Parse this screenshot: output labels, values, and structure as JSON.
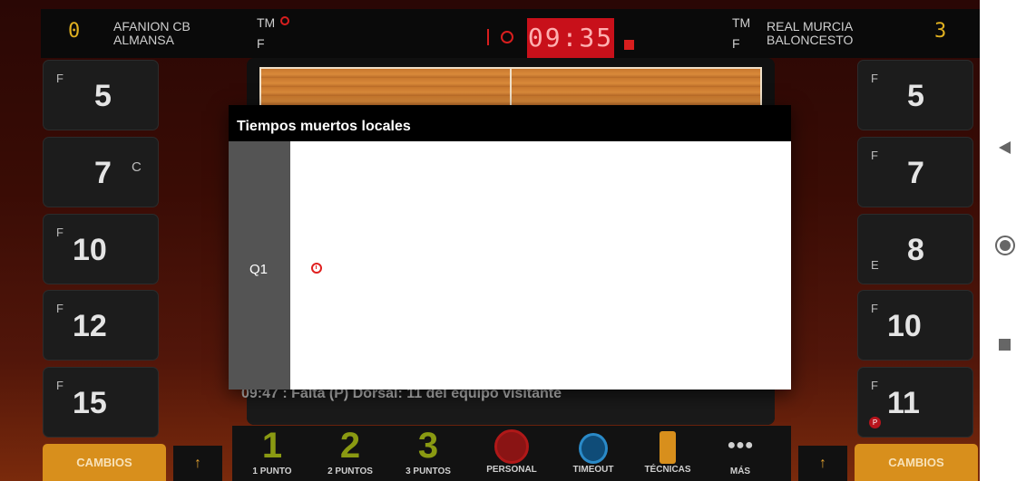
{
  "header": {
    "home_score_display": "0",
    "home_name_line1": "AFANION CB",
    "home_name_line2": "ALMANSA",
    "home_tm_label": "TM",
    "home_f_label": "F",
    "clock": "09:35",
    "away_tm_label": "TM",
    "away_f_label": "F",
    "away_name_line1": "REAL MURCIA",
    "away_name_line2": "BALONCESTO",
    "away_score_display": "3"
  },
  "home_players": [
    {
      "tag": "F",
      "number": "5",
      "extra": ""
    },
    {
      "tag": "",
      "number": "7",
      "extra": "C"
    },
    {
      "tag": "F",
      "number": "10",
      "extra": ""
    },
    {
      "tag": "F",
      "number": "12",
      "extra": ""
    },
    {
      "tag": "F",
      "number": "15",
      "extra": ""
    }
  ],
  "away_players": [
    {
      "tag": "F",
      "number": "5",
      "extra": ""
    },
    {
      "tag": "F",
      "number": "7",
      "extra": ""
    },
    {
      "tag": "E",
      "number": "8",
      "extra": ""
    },
    {
      "tag": "F",
      "number": "10",
      "extra": ""
    },
    {
      "tag": "F",
      "number": "11",
      "extra": "P"
    }
  ],
  "log": {
    "last_event": "09:47 : Falta (P) Dorsal: 11 del equipo visitante"
  },
  "dialog": {
    "title": "Tiempos muertos locales",
    "quarter": "Q1"
  },
  "actions": [
    {
      "big": "1",
      "label": "1 PUNTO",
      "color": "#8a9a12"
    },
    {
      "big": "2",
      "label": "2 PUNTOS",
      "color": "#8a9a12"
    },
    {
      "big": "3",
      "label": "3 PUNTOS",
      "color": "#8a9a12"
    },
    {
      "big": "",
      "label": "PERSONAL",
      "color": "#b01818"
    },
    {
      "big": "",
      "label": "TIMEOUT",
      "color": "#2a8ac8"
    },
    {
      "big": "",
      "label": "TÉCNICAS",
      "color": "#d88f1c"
    },
    {
      "big": "●●●",
      "label": "MÁS",
      "color": "#cfcfcf"
    }
  ],
  "bottom": {
    "left_cambios": "CAMBIOS",
    "right_cambios": "CAMBIOS",
    "arrow": "↑"
  },
  "colors": {
    "accent": "#d88f1c",
    "clock_bg": "#c8101a",
    "dialog_header": "#000000"
  }
}
